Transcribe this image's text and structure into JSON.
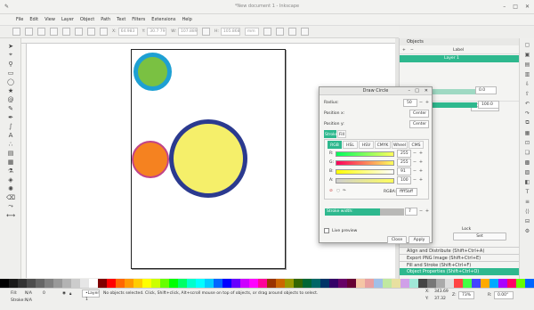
{
  "window": {
    "title": "*New document 1 - Inkscape",
    "icon": "inkscape-logo-icon"
  },
  "menu": [
    "File",
    "Edit",
    "View",
    "Layer",
    "Object",
    "Path",
    "Text",
    "Filters",
    "Extensions",
    "Help"
  ],
  "toolcontrols": {
    "x_label": "X:",
    "x_value": "64.983",
    "y_label": "Y:",
    "y_value": "30.7 79",
    "w_label": "W:",
    "w_value": "107.889",
    "h_label": "H:",
    "h_value": "105.868",
    "unit": "mm"
  },
  "canvas": {
    "circles": [
      {
        "name": "green-circle",
        "fill": "#7ac142",
        "stroke": "#1ea0d3"
      },
      {
        "name": "orange-circle",
        "fill": "#f58220",
        "stroke": "#c0448a"
      },
      {
        "name": "yellow-circle",
        "fill": "#f5ef6a",
        "stroke": "#2b3a8f"
      }
    ]
  },
  "dock": {
    "objects_tab": "Objects",
    "layer_label": "Layer 1",
    "label_header": "Label",
    "blend_label": "Blend mode:",
    "blend_value": "Normal",
    "opacity_value": "0.0",
    "opacity_value2": "100.0",
    "lock_label": "Lock",
    "set_button": "Set",
    "panels": [
      "Align and Distribute (Shift+Ctrl+A)",
      "Export PNG Image (Shift+Ctrl+E)",
      "Fill and Stroke (Shift+Ctrl+F)",
      "Object Properties (Shift+Ctrl+O)"
    ]
  },
  "dialog": {
    "title": "Draw Circle",
    "radius_label": "Radius:",
    "radius_value": "50",
    "posx_label": "Position x:",
    "posx_value": "Center",
    "posy_label": "Position y:",
    "posy_value": "Center",
    "tabs": [
      "Stroke",
      "Fill"
    ],
    "color_modes": [
      "RGB",
      "HSL",
      "HSV",
      "CMYK",
      "Wheel",
      "CMS"
    ],
    "channels": [
      {
        "label": "R:",
        "value": "255"
      },
      {
        "label": "G:",
        "value": "255"
      },
      {
        "label": "B:",
        "value": "91"
      },
      {
        "label": "A:",
        "value": "100"
      }
    ],
    "rgba_label": "RGBA:",
    "rgba_value": "ffff5bff",
    "stroke_width_label": "Stroke width:",
    "stroke_width_value": "7",
    "live_preview_label": "Live preview",
    "close_button": "Close",
    "apply_button": "Apply"
  },
  "status": {
    "fill_label": "Fill:",
    "fill_value": "N/A",
    "stroke_label": "Stroke:",
    "stroke_value": "N/A",
    "zero": "0",
    "layer": "•Layer 1",
    "message": "No objects selected. Click, Shift+click, Alt+scroll mouse on top of objects, or drag around objects to select.",
    "x_label": "X:",
    "x_value": "343.69",
    "y_label": "Y:",
    "y_value": "37.32",
    "z_label": "Z:",
    "zoom": "73%",
    "r_label": "R:",
    "rotation": "0.00°"
  },
  "palette": [
    "#000000",
    "#1a1a1a",
    "#333333",
    "#4d4d4d",
    "#666666",
    "#808080",
    "#999999",
    "#b3b3b3",
    "#cccccc",
    "#e6e6e6",
    "#ffffff",
    "#800000",
    "#ff0000",
    "#ff6600",
    "#ff9900",
    "#ffcc00",
    "#ffff00",
    "#ccff00",
    "#66ff00",
    "#00ff00",
    "#00ff66",
    "#00ffcc",
    "#00ffff",
    "#00ccff",
    "#0066ff",
    "#0000ff",
    "#6600ff",
    "#cc00ff",
    "#ff00ff",
    "#ff0099",
    "#993300",
    "#cc6600",
    "#999900",
    "#336600",
    "#006633",
    "#006666",
    "#003366",
    "#330066",
    "#660066",
    "#660033",
    "#f5c6a5",
    "#e8a0a0",
    "#a0c0e8",
    "#c0e8a0",
    "#e8e0a0",
    "#d0a0e8",
    "#a0e8d8",
    "#444444",
    "#777777",
    "#aaaaaa",
    "#dddddd",
    "#ff4444",
    "#44ff44",
    "#4444ff",
    "#ffaa00",
    "#00aaff",
    "#aa00ff",
    "#ff0066",
    "#66ff00",
    "#0066ff"
  ]
}
